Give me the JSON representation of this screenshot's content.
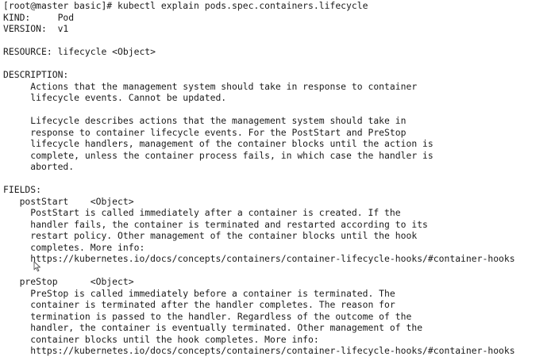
{
  "terminal": {
    "lines": [
      "[root@master basic]# kubectl explain pods.spec.containers.lifecycle",
      "KIND:     Pod",
      "VERSION:  v1",
      "",
      "RESOURCE: lifecycle <Object>",
      "",
      "DESCRIPTION:",
      "     Actions that the management system should take in response to container",
      "     lifecycle events. Cannot be updated.",
      "",
      "     Lifecycle describes actions that the management system should take in",
      "     response to container lifecycle events. For the PostStart and PreStop",
      "     lifecycle handlers, management of the container blocks until the action is",
      "     complete, unless the container process fails, in which case the handler is",
      "     aborted.",
      "",
      "FIELDS:",
      "   postStart    <Object>",
      "     PostStart is called immediately after a container is created. If the",
      "     handler fails, the container is terminated and restarted according to its",
      "     restart policy. Other management of the container blocks until the hook",
      "     completes. More info:",
      "     https://kubernetes.io/docs/concepts/containers/container-lifecycle-hooks/#container-hooks",
      "",
      "   preStop      <Object>",
      "     PreStop is called immediately before a container is terminated. The",
      "     container is terminated after the handler completes. The reason for",
      "     termination is passed to the handler. Regardless of the outcome of the",
      "     handler, the container is eventually terminated. Other management of the",
      "     container blocks until the hook completes. More info:",
      "     https://kubernetes.io/docs/concepts/containers/container-lifecycle-hooks/#container-hooks"
    ]
  }
}
